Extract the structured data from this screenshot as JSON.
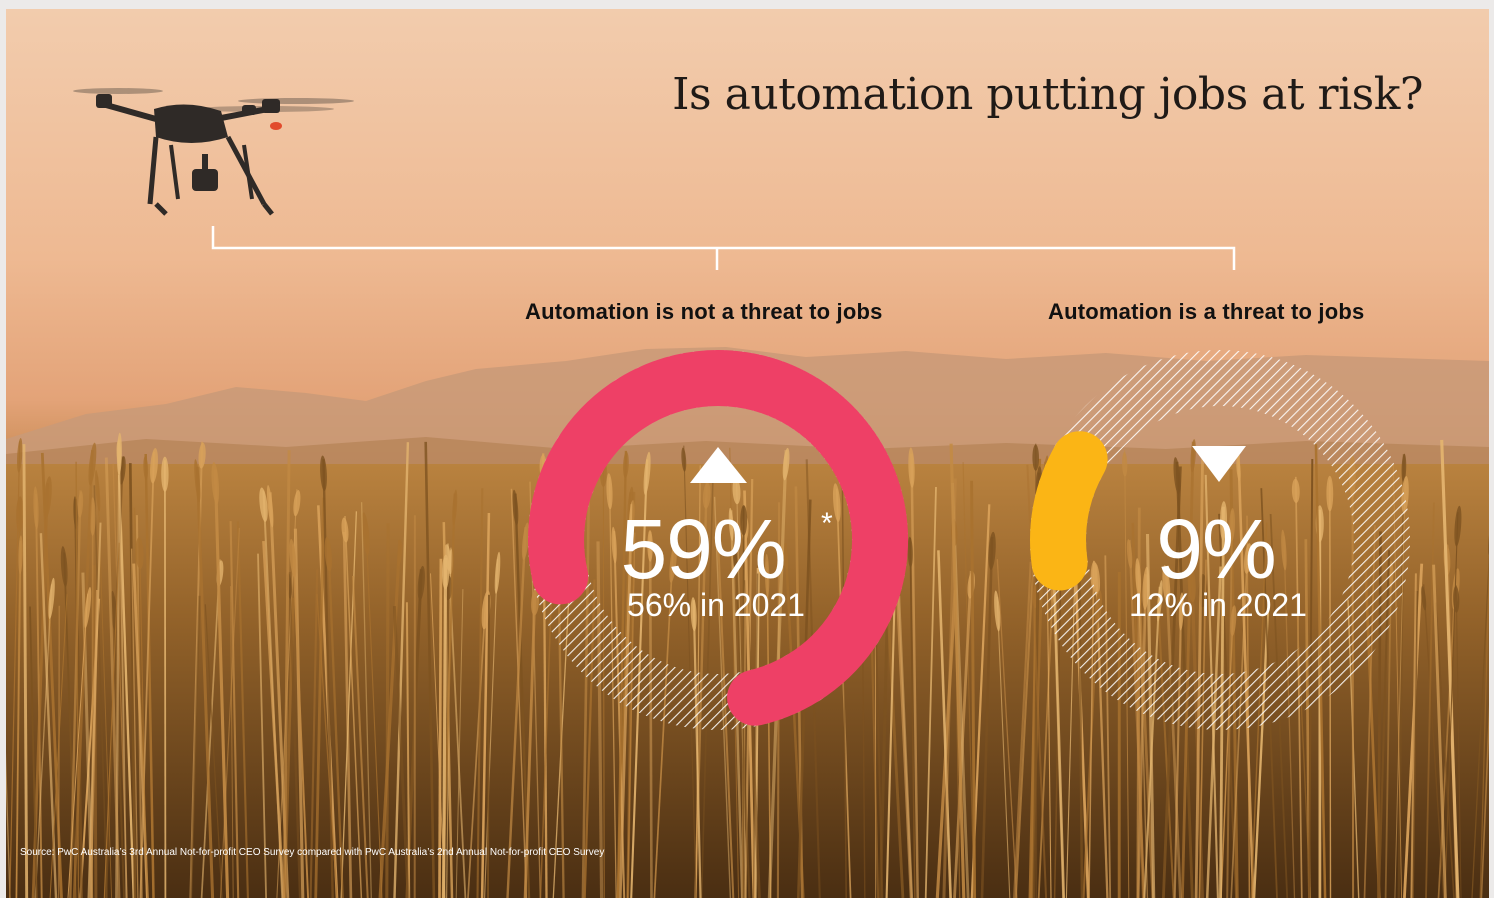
{
  "title": "Is automation putting jobs at risk?",
  "source": "Source: PwC Australia’s 3rd Annual Not-for-profit CEO Survey compared with PwC Australia’s 2nd Annual Not-for-profit CEO Survey",
  "colors": {
    "not_threat": "#ee4066",
    "threat": "#fbb515",
    "hatch": "#ffffff",
    "title": "#1f1a17"
  },
  "chart_data": {
    "type": "donut",
    "categories": [
      "Automation is not a threat to jobs",
      "Automation is a threat to jobs"
    ],
    "series": [
      {
        "values": [
          59,
          9
        ]
      },
      {
        "values": [
          56,
          12
        ]
      }
    ],
    "items": [
      {
        "label": "Automation is not a threat to jobs",
        "value": 59,
        "value_text": "59%",
        "footnote": "*",
        "trend": "up",
        "trend_icon": "triangle-up-icon",
        "prior_value": 56,
        "prior_text": "56% in 2021",
        "color": "#ee4066"
      },
      {
        "label": "Automation is a threat to jobs",
        "value": 9,
        "value_text": "9%",
        "footnote": "",
        "trend": "down",
        "trend_icon": "triangle-down-icon",
        "prior_value": 12,
        "prior_text": "12% in 2021",
        "color": "#fbb515"
      }
    ]
  }
}
